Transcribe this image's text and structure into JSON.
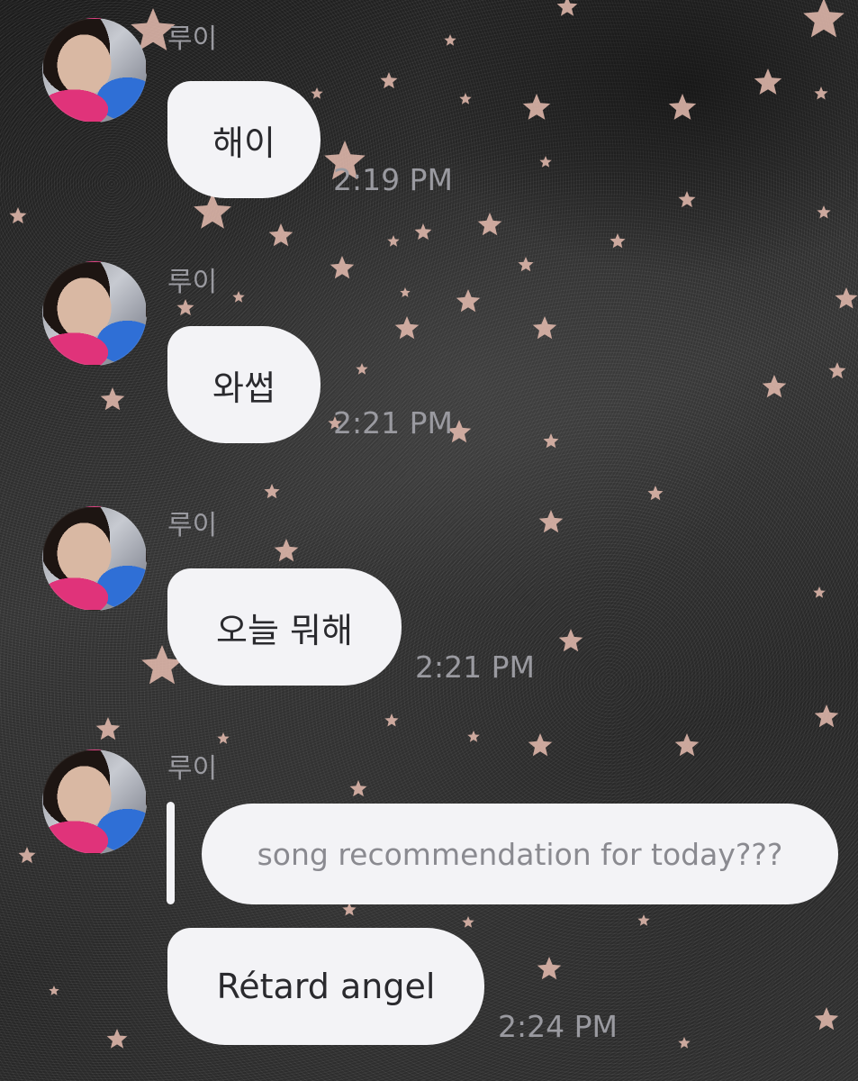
{
  "colors": {
    "bubble": "#f3f3f6",
    "bubble_text": "#2a2a2e",
    "meta_text": "#9a9aa0",
    "star": "#e8bdb0",
    "background": "#2a2a2a"
  },
  "messages": [
    {
      "sender": "루이",
      "text": "해이",
      "time": "2:19 PM"
    },
    {
      "sender": "루이",
      "text": "와썹",
      "time": "2:21 PM"
    },
    {
      "sender": "루이",
      "text": "오늘 뭐해",
      "time": "2:21 PM"
    },
    {
      "sender": "루이",
      "reply_to": "song recommendation for today???",
      "text": "Rétard angel",
      "time": "2:24 PM"
    }
  ]
}
